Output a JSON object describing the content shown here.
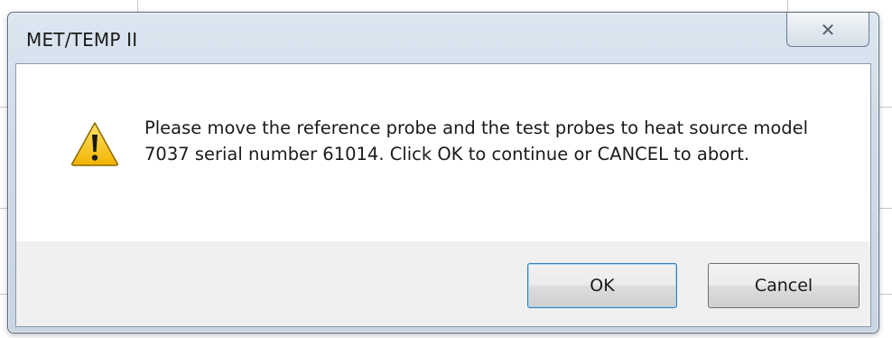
{
  "window": {
    "title": "MET/TEMP II",
    "close_glyph": "✕"
  },
  "message": {
    "icon": "warning-icon",
    "text": "Please move the reference probe and the test probes to heat source model 7037 serial number 61014. Click OK to continue or CANCEL to abort."
  },
  "buttons": {
    "ok_label": "OK",
    "cancel_label": "Cancel"
  },
  "colors": {
    "warning_fill": "#f5c400",
    "warning_border": "#8a6a00",
    "ok_focus": "#3c7fb1"
  }
}
